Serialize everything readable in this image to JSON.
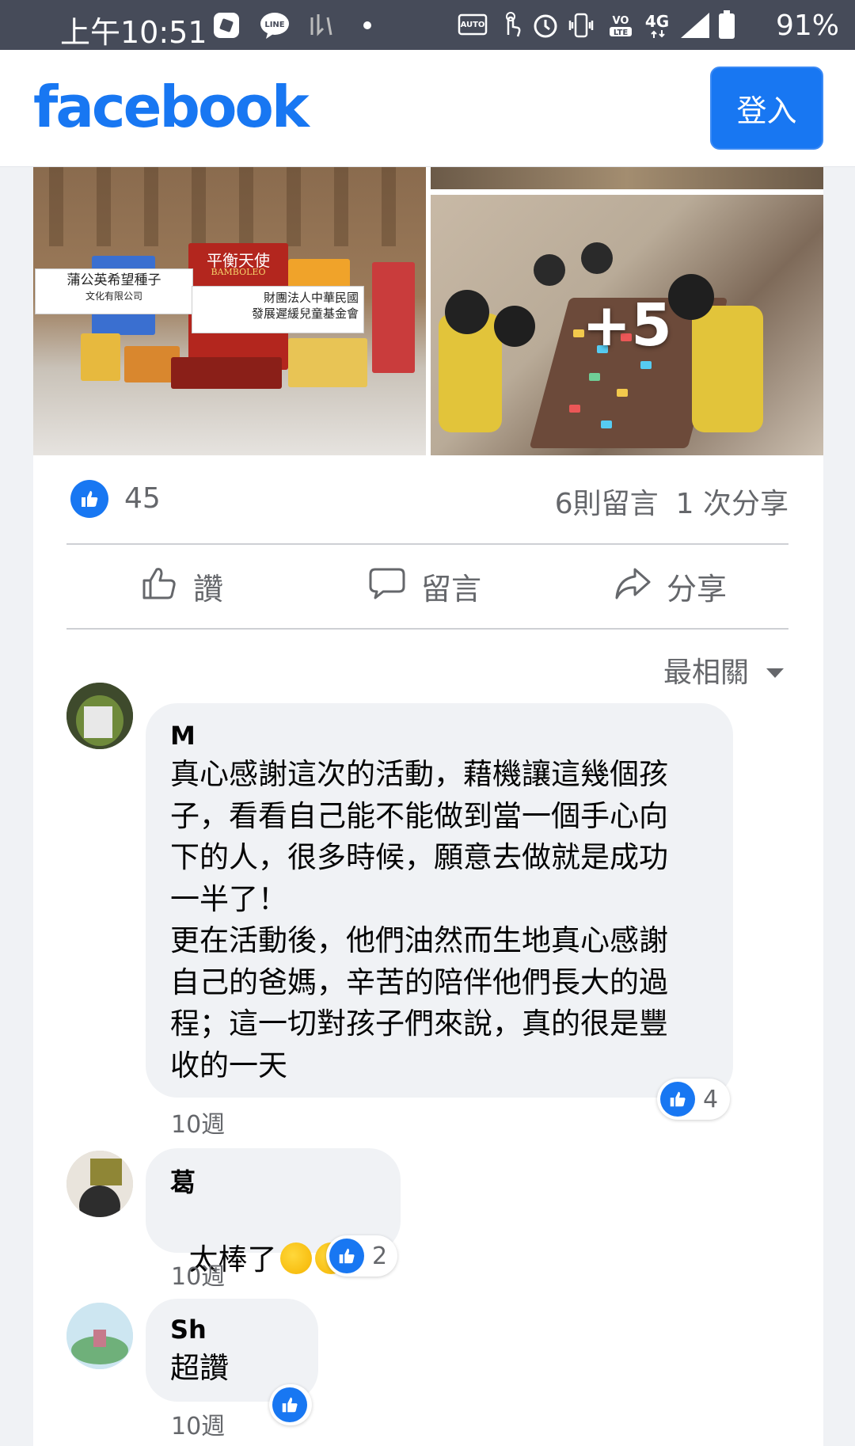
{
  "status_bar": {
    "time": "上午10:51",
    "icons": [
      "app-icon",
      "line-icon",
      "notification-icon",
      "dot-icon",
      "auto-hz-icon",
      "touch-icon",
      "alarm-icon",
      "vibrate-icon",
      "volte-icon",
      "4g-icon",
      "signal-icon",
      "battery-icon"
    ],
    "network": "4G",
    "battery": "91%"
  },
  "header": {
    "logo": "facebook",
    "login_label": "登入"
  },
  "post": {
    "photos": {
      "left_sign_1": "蒲公英希望種子",
      "left_sign_1_sub": "文化有限公司",
      "left_sign_2_line1": "財團法人中華民國",
      "left_sign_2_line2": "發展遲緩兒童基金會",
      "game_box_title": "平衡天使",
      "game_box_sub": "BAMBOLEO",
      "more_count": "+5"
    },
    "reactions_count": "45",
    "comments_count": "6則留言",
    "shares_count": "1 次分享",
    "actions": {
      "like": "讚",
      "comment": "留言",
      "share": "分享"
    },
    "sort_label": "最相關"
  },
  "comments": [
    {
      "name": "M",
      "text": "真心感謝這次的活動，藉機讓這幾個孩\n子，看看自己能不能做到當一個手心向\n下的人，很多時候，願意去做就是成功\n一半了！\n更在活動後，他們油然而生地真心感謝\n自己的爸媽，辛苦的陪伴他們長大的過\n程；這一切對孩子們來說，真的很是豐\n收的一天",
      "time": "10週",
      "likes": "4"
    },
    {
      "name": "葛",
      "text": "太棒了",
      "time": "10週",
      "likes": "2"
    },
    {
      "name": "Sh",
      "text": "超讚",
      "time": "10週",
      "likes": ""
    }
  ]
}
